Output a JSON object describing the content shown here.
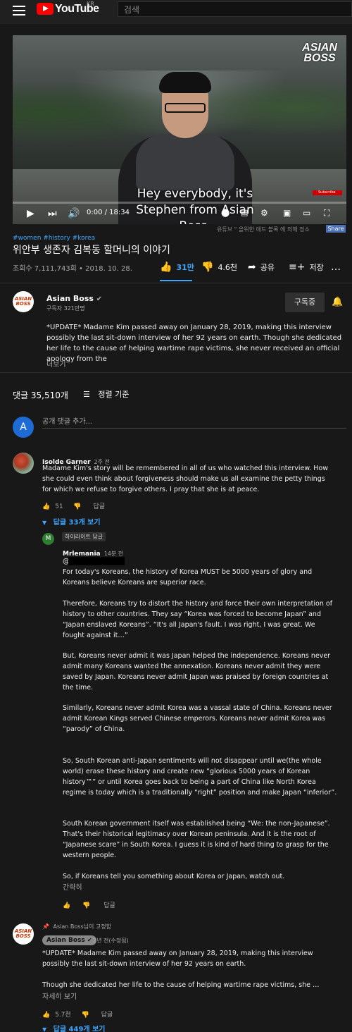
{
  "header": {
    "logo_text": "YouTube",
    "region": "KR",
    "search_placeholder": "검색"
  },
  "player": {
    "brand": "ASIAN BOSS",
    "subtitle": "Hey everybody, it's Stephen from Asian Boss.",
    "subscribe_overlay": "Subscribe",
    "time": "0:00 / 18:34",
    "progress": 0.0
  },
  "sponsor_text": "유튜브 \" 올위한 애드 블록 에 의해 정소",
  "share_label": "Share",
  "video": {
    "hashtags": "#women #history #korea",
    "title": "위안부 생존자 김복동 할머니의 이야기",
    "meta": "조회수 7,111,743회 • 2018. 10. 28.",
    "likes": "31만",
    "dislikes": "4.6천",
    "share": "공유",
    "save": "저장",
    "more": "…"
  },
  "channel": {
    "name": "Asian Boss",
    "avatar_text": "ASIAN BOSS",
    "subscribers": "구독자 321만명",
    "subscribed_label": "구독중",
    "description": "*UPDATE* Madame Kim passed away on January 28, 2019, making this interview possibly the last sit-down interview of her 92 years on earth. Though she dedicated her life to the cause of helping wartime rape victims, she never received an official apology from the",
    "more_label": "더보기"
  },
  "comments": {
    "count": "댓글 35,510개",
    "sort_label": "정렬 기준",
    "my_avatar": "A",
    "add_placeholder": "공개 댓글 추가...",
    "reply_label": "답글",
    "items": [
      {
        "author": "Isolde Garner",
        "time": "2주 전",
        "text": "Madame Kim's story will be remembered in all of us who watched this interview. How she could even think about forgiveness should make us all examine the petty things for which we refuse to forgive others. I pray that she is at peace.",
        "likes": "51",
        "view_replies": "답글 33개 보기"
      }
    ],
    "reply": {
      "avatar": "M",
      "highlight": "하이라이트 답글",
      "author": "Mrlemania",
      "time": "14분 전",
      "mention": "@",
      "paragraphs": [
        "For today's Koreans, the history of Korea MUST be 5000 years of glory and Koreans believe Koreans are superior race.",
        "Therefore, Koreans try to distort the history and force their own interpretation of history to other countries. They say “Korea was forced to become Japan” and “Japan enslaved Koreans”. “It's all Japan's fault. I was right, I was great. We fought against it…”",
        "But, Koreans never admit it was Japan helped the independence. Koreans never admit many Koreans wanted the annexation. Koreans never admit they were saved by Japan. Koreans never admit Japan was praised by foreign countries at the time.",
        "Similarly, Koreans never admit Korea was a vassal state of China. Koreans never admit Korean Kings served Chinese emperors. Koreans never admit Korea was “parody” of China.",
        "So, South Korean anti-Japan sentiments will not disappear until we(the whole world) erase these history and create new “glorious 5000 years of Korean history™” or until Korea goes back to being a part of China like North Korea regime is today which is a traditionally “right” position and make Japan “inferior”.",
        "South Korean government itself was established being “We: the non-Japanese”. That's their historical legitimacy over Korean peninsula. And it is the root of “Japanese scare” in South Korea. I guess it is kind of hard thing to grasp for the western people.",
        "So, if Koreans tell you something about Korea or Japan, watch out."
      ],
      "less_label": "간략히"
    },
    "pinned": {
      "pinned_by": "Asian Boss님이 고정함",
      "author": "Asian Boss",
      "time": "2년 전(수정됨)",
      "text1": "*UPDATE* Madame Kim passed away on January 28, 2019, making this interview possibly the last sit-down interview of her 92 years on earth.",
      "text2": "Though she dedicated her life to the cause of helping wartime rape victims, she …",
      "more_label": "자세히 보기",
      "likes": "5.7천",
      "view_replies": "답글 449개 보기"
    }
  }
}
